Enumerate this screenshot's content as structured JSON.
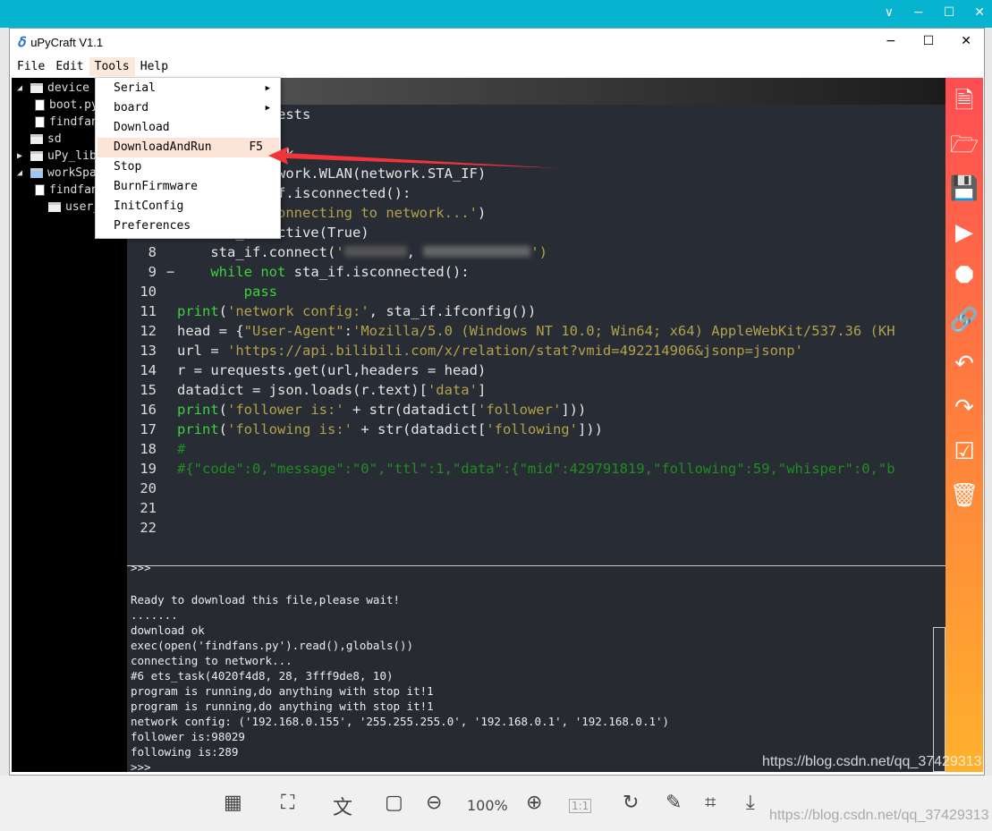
{
  "window": {
    "title": "uPyCraft V1.1",
    "minimize": "−",
    "maximize": "☐",
    "close": "✕"
  },
  "outer": {
    "controls": [
      "∨",
      "−",
      "☐",
      "✕"
    ]
  },
  "menubar": [
    "File",
    "Edit",
    "Tools",
    "Help"
  ],
  "tools_menu": [
    {
      "label": "Serial",
      "submenu": true
    },
    {
      "label": "board",
      "submenu": true
    },
    {
      "label": "Download"
    },
    {
      "label": "DownloadAndRun",
      "shortcut": "F5",
      "highlighted": true
    },
    {
      "label": "Stop"
    },
    {
      "label": "BurnFirmware"
    },
    {
      "label": "InitConfig"
    },
    {
      "label": "Preferences"
    }
  ],
  "tree": [
    {
      "label": "device",
      "type": "folder",
      "expanded": true
    },
    {
      "label": "boot.py",
      "type": "file"
    },
    {
      "label": "findfans.py",
      "type": "file"
    },
    {
      "label": "sd",
      "type": "folder"
    },
    {
      "label": "uPy_lib",
      "type": "folder",
      "expanded": false
    },
    {
      "label": "workSpace",
      "type": "folder",
      "expanded": true
    },
    {
      "label": "findfans.py",
      "type": "file"
    },
    {
      "label": "user_lib",
      "type": "folder"
    }
  ],
  "code_lines": [
    "import urequests",
    "import json",
    "import network",
    "sta_if = network.WLAN(network.STA_IF)",
    "if not sta_if.isconnected():",
    "    print('connecting to network...')",
    "    sta_if.active(True)",
    "    sta_if.connect('','')",
    "    while not sta_if.isconnected():",
    "        pass",
    "print('network config:', sta_if.ifconfig())",
    "head = {\"User-Agent\":'Mozilla/5.0 (Windows NT 10.0; Win64; x64) AppleWebKit/537.36 (KH",
    "url = 'https://api.bilibili.com/x/relation/stat?vmid=492214906&jsonp=jsonp'",
    "r = urequests.get(url,headers = head)",
    "datadict = json.loads(r.text)['data']",
    "print('follower is:' + str(datadict['follower']))",
    "print('following is:' + str(datadict['following']))",
    "#",
    "#{\"code\":0,\"message\":\"0\",\"ttl\":1,\"data\":{\"mid\":429791819,\"following\":59,\"whisper\":0,\"b",
    "",
    "",
    ""
  ],
  "terminal": [
    ">>>",
    "",
    "Ready to download this file,please wait!",
    ".......",
    "download ok",
    "exec(open('findfans.py').read(),globals())",
    "connecting to network...",
    "#6 ets_task(4020f4d8, 28, 3fff9de8, 10)",
    "program is running,do anything with stop it!1",
    "program is running,do anything with stop it!1",
    "network config: ('192.168.0.155', '255.255.255.0', '192.168.0.1', '192.168.0.1')",
    "follower is:98029",
    "following is:289",
    ">>>"
  ],
  "sidebar_tools": [
    "new-file",
    "open-file",
    "save",
    "run",
    "stop",
    "connect",
    "undo",
    "redo",
    "syntax-check",
    "clear"
  ],
  "bottom_toolbar": {
    "zoom": "100%",
    "one_to_one": "1:1"
  },
  "watermark": "https://blog.csdn.net/qq_37429313",
  "colors": {
    "outer_titlebar": "#06b4cf",
    "sidebar_top": "#ff4d52",
    "sidebar_bottom": "#ffb12d",
    "keyword": "#3fd13f",
    "string": "#b3a24a",
    "comment": "#1f8f1f"
  }
}
